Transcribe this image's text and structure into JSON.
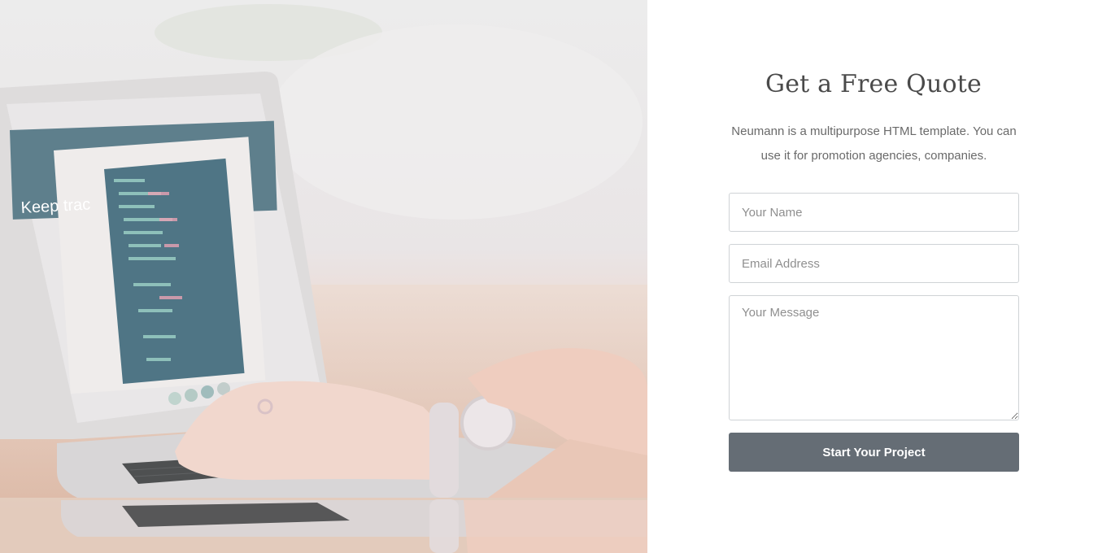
{
  "quote": {
    "title": "Get a Free Quote",
    "description": "Neumann is a multipurpose HTML template. You can use it for promotion agencies, companies.",
    "name_placeholder": "Your Name",
    "email_placeholder": "Email Address",
    "message_placeholder": "Your Message",
    "submit_label": "Start Your Project"
  },
  "photo": {
    "screen_text": "Keep trac"
  },
  "colors": {
    "button": "#656d75",
    "border": "#cfd3d6",
    "title": "#4a4a4a"
  }
}
